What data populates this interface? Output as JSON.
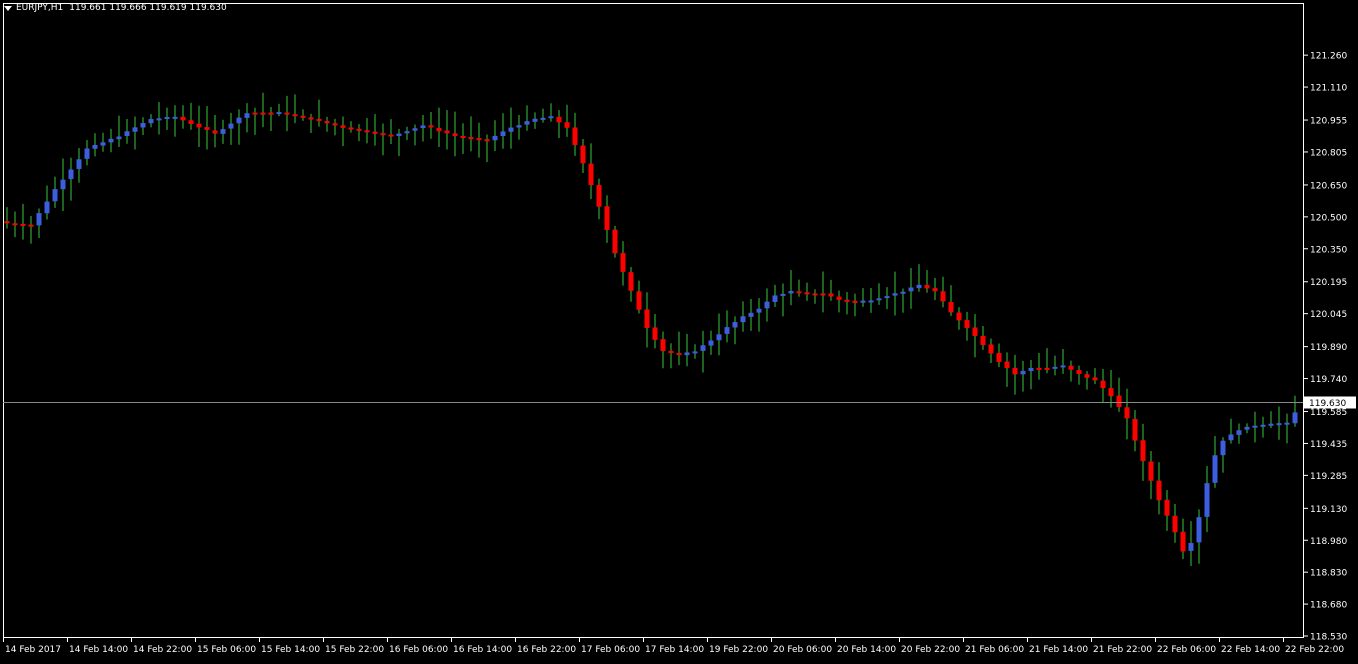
{
  "header": {
    "symbol": "EURJPY,H1",
    "quotes": "119.661 119.666 119.619 119.630"
  },
  "colors": {
    "background": "#000000",
    "foreground": "#ffffff",
    "bull_body": "#3d5ee0",
    "bear_body": "#ff0000",
    "wick": "#39c83b",
    "bid_line": "#8a8a8a",
    "bid_label_bg": "#ffffff",
    "bid_label_text": "#000000"
  },
  "chart_data": {
    "type": "candlestick",
    "symbol": "EURJPY",
    "timeframe": "H1",
    "current_price": 119.63,
    "ylim": [
      118.53,
      121.35
    ],
    "y_ticks": [
      "121.260",
      "121.110",
      "120.955",
      "120.805",
      "120.650",
      "120.500",
      "120.350",
      "120.195",
      "120.045",
      "119.890",
      "119.740",
      "119.585",
      "119.435",
      "119.285",
      "119.130",
      "118.980",
      "118.830",
      "118.680",
      "118.530"
    ],
    "x_ticks": [
      "14 Feb 2017",
      "14 Feb 14:00",
      "14 Feb 22:00",
      "15 Feb 06:00",
      "15 Feb 14:00",
      "15 Feb 22:00",
      "16 Feb 06:00",
      "16 Feb 14:00",
      "16 Feb 22:00",
      "17 Feb 06:00",
      "17 Feb 14:00",
      "19 Feb 22:00",
      "20 Feb 06:00",
      "20 Feb 14:00",
      "20 Feb 22:00",
      "21 Feb 06:00",
      "21 Feb 14:00",
      "21 Feb 22:00",
      "22 Feb 06:00",
      "22 Feb 14:00",
      "22 Feb 22:00"
    ],
    "anchors": [
      [
        0,
        120.47
      ],
      [
        3,
        120.46
      ],
      [
        6,
        120.63
      ],
      [
        10,
        120.82
      ],
      [
        14,
        120.88
      ],
      [
        18,
        120.96
      ],
      [
        21,
        120.97
      ],
      [
        26,
        120.89
      ],
      [
        30,
        120.99
      ],
      [
        34,
        120.99
      ],
      [
        38,
        120.96
      ],
      [
        42,
        120.92
      ],
      [
        48,
        120.88
      ],
      [
        52,
        120.93
      ],
      [
        56,
        120.88
      ],
      [
        60,
        120.86
      ],
      [
        63,
        120.92
      ],
      [
        66,
        120.96
      ],
      [
        68,
        120.97
      ],
      [
        70,
        120.92
      ],
      [
        72,
        120.75
      ],
      [
        74,
        120.55
      ],
      [
        76,
        120.33
      ],
      [
        78,
        120.15
      ],
      [
        80,
        119.98
      ],
      [
        82,
        119.87
      ],
      [
        84,
        119.85
      ],
      [
        86,
        119.87
      ],
      [
        88,
        119.92
      ],
      [
        90,
        119.98
      ],
      [
        92,
        120.03
      ],
      [
        94,
        120.07
      ],
      [
        96,
        120.13
      ],
      [
        98,
        120.15
      ],
      [
        100,
        120.14
      ],
      [
        102,
        120.14
      ],
      [
        104,
        120.11
      ],
      [
        106,
        120.1
      ],
      [
        108,
        120.11
      ],
      [
        110,
        120.13
      ],
      [
        112,
        120.15
      ],
      [
        114,
        120.18
      ],
      [
        116,
        120.15
      ],
      [
        118,
        120.05
      ],
      [
        120,
        119.98
      ],
      [
        122,
        119.9
      ],
      [
        124,
        119.82
      ],
      [
        126,
        119.76
      ],
      [
        128,
        119.79
      ],
      [
        130,
        119.79
      ],
      [
        132,
        119.8
      ],
      [
        134,
        119.76
      ],
      [
        136,
        119.73
      ],
      [
        138,
        119.66
      ],
      [
        140,
        119.55
      ],
      [
        142,
        119.35
      ],
      [
        144,
        119.17
      ],
      [
        146,
        119.02
      ],
      [
        147,
        118.93
      ],
      [
        148,
        118.97
      ],
      [
        149,
        119.09
      ],
      [
        150,
        119.25
      ],
      [
        151,
        119.38
      ],
      [
        152,
        119.45
      ],
      [
        154,
        119.5
      ],
      [
        156,
        119.52
      ],
      [
        158,
        119.53
      ],
      [
        160,
        119.53
      ],
      [
        161,
        119.58
      ]
    ],
    "candle_count": 162
  }
}
